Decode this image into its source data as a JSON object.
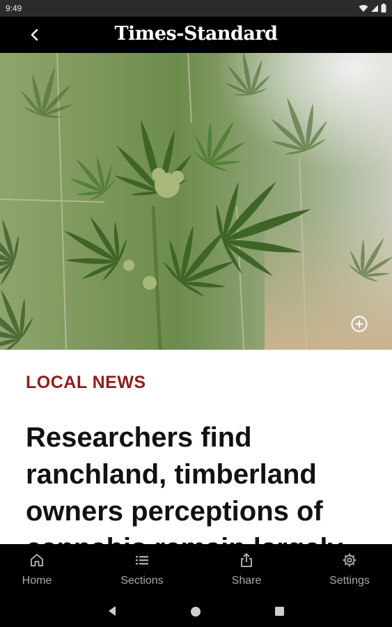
{
  "status_bar": {
    "time": "9:49"
  },
  "app_bar": {
    "masthead": "Times-Standard"
  },
  "article": {
    "category": "LOCAL NEWS",
    "headline": "Researchers find ranchland, timberland owners perceptions of cannabis remain largely"
  },
  "bottom_nav": {
    "items": [
      {
        "label": "Home",
        "icon": "home-icon"
      },
      {
        "label": "Sections",
        "icon": "list-icon"
      },
      {
        "label": "Share",
        "icon": "share-icon"
      },
      {
        "label": "Settings",
        "icon": "gear-icon"
      }
    ]
  },
  "colors": {
    "category": "#8f1c1c",
    "app_bar": "#000000",
    "nav_inactive": "#a9a9a9"
  }
}
